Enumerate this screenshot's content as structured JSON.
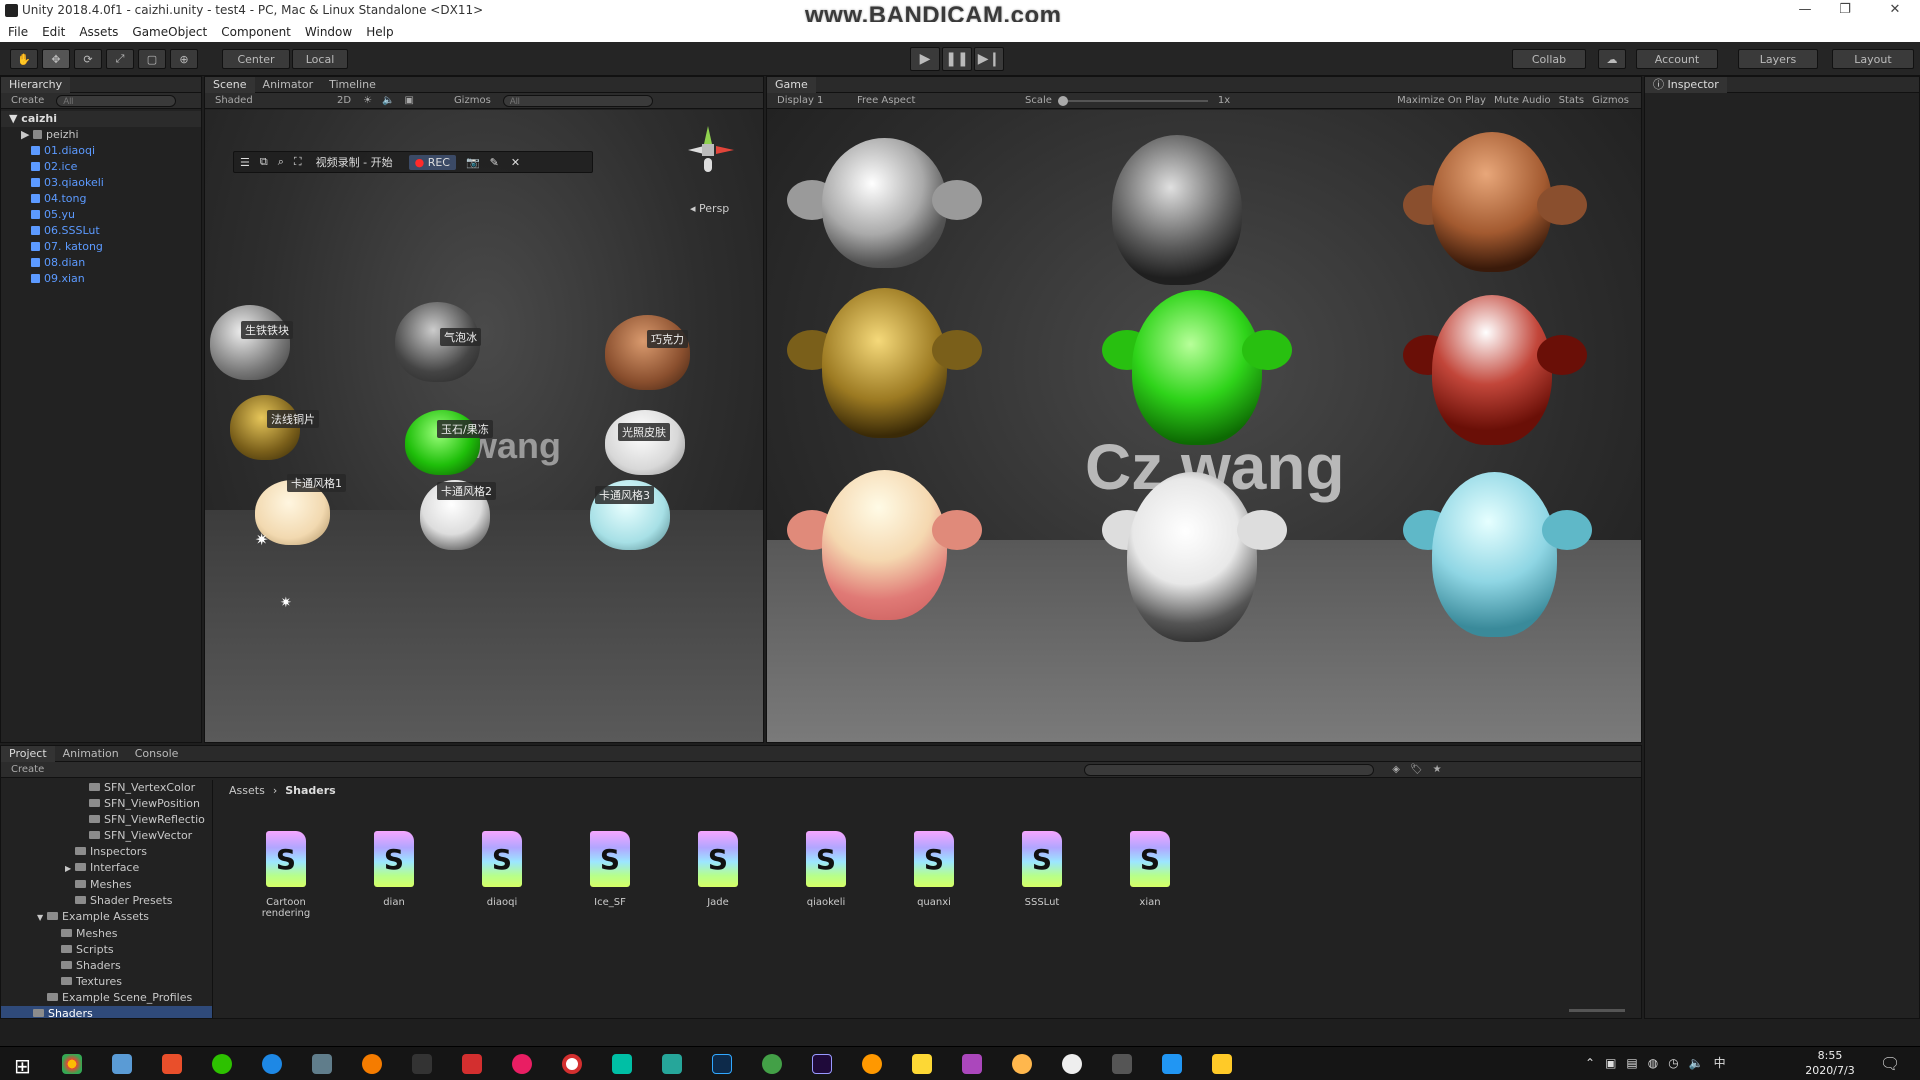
{
  "title": "Unity 2018.4.0f1 - caizhi.unity - test4 - PC, Mac & Linux Standalone <DX11>",
  "watermark": "www.BANDICAM.com",
  "menu": [
    "File",
    "Edit",
    "Assets",
    "GameObject",
    "Component",
    "Window",
    "Help"
  ],
  "toolbar": {
    "center": "Center",
    "local": "Local",
    "collab": "Collab",
    "account": "Account",
    "layers": "Layers",
    "layout": "Layout"
  },
  "hierarchy": {
    "tab": "Hierarchy",
    "create": "Create",
    "search_placeholder": "All",
    "scene": "caizhi",
    "items": [
      "peizhi",
      "01.diaoqi",
      "02.ice",
      "03.qiaokeli",
      "04.tong",
      "05.yu",
      "06.SSSLut",
      "07. katong",
      "08.dian",
      "09.xian"
    ]
  },
  "scene": {
    "tabs": [
      "Scene",
      "Animator",
      "Timeline"
    ],
    "shaded": "Shaded",
    "mode2d": "2D",
    "gizmos": "Gizmos",
    "search_placeholder": "All",
    "persp": "Persp",
    "rec_bar": {
      "title": "视频录制 - 开始",
      "rec": "REC"
    },
    "labels": [
      "生铁铁块",
      "气泡冰",
      "巧克力",
      "法线铜片",
      "玉石/果冻",
      "光照皮肤",
      "卡通风格1",
      "卡通风格2",
      "卡通风格3"
    ],
    "watermark": "Cz wang"
  },
  "game": {
    "tab": "Game",
    "display": "Display 1",
    "aspect": "Free Aspect",
    "scale_label": "Scale",
    "scale_value": "1x",
    "options": [
      "Maximize On Play",
      "Mute Audio",
      "Stats",
      "Gizmos"
    ],
    "watermark": "Cz wang"
  },
  "inspector": {
    "tab": "Inspector"
  },
  "project": {
    "tabs": [
      "Project",
      "Animation",
      "Console"
    ],
    "create": "Create",
    "breadcrumb": [
      "Assets",
      "Shaders"
    ],
    "tree": [
      {
        "name": "SFN_VertexColor",
        "indent": 5
      },
      {
        "name": "SFN_ViewPosition",
        "indent": 5
      },
      {
        "name": "SFN_ViewReflectio",
        "indent": 5
      },
      {
        "name": "SFN_ViewVector",
        "indent": 5
      },
      {
        "name": "Inspectors",
        "indent": 4
      },
      {
        "name": "Interface",
        "indent": 4,
        "arrow": "▶"
      },
      {
        "name": "Meshes",
        "indent": 4
      },
      {
        "name": "Shader Presets",
        "indent": 4
      },
      {
        "name": "Example Assets",
        "indent": 2,
        "arrow": "▼"
      },
      {
        "name": "Meshes",
        "indent": 3
      },
      {
        "name": "Scripts",
        "indent": 3
      },
      {
        "name": "Shaders",
        "indent": 3
      },
      {
        "name": "Textures",
        "indent": 3
      },
      {
        "name": "Example Scene_Profiles",
        "indent": 2
      },
      {
        "name": "Shaders",
        "indent": 1,
        "selected": true
      }
    ],
    "assets": [
      "Cartoon rendering",
      "dian",
      "diaoqi",
      "Ice_SF",
      "Jade",
      "qiaokeli",
      "quanxi",
      "SSSLut",
      "xian"
    ]
  },
  "taskbar": {
    "time": "8:55",
    "date": "2020/7/3",
    "ime": "中"
  }
}
